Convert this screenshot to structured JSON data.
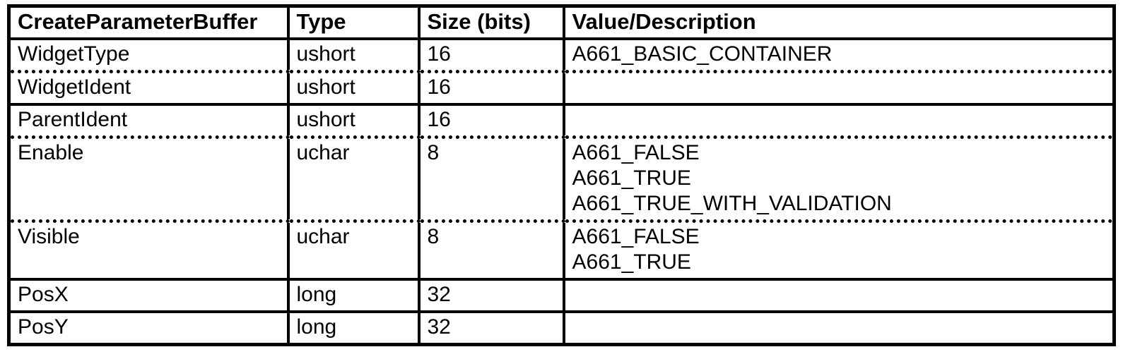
{
  "headers": {
    "name": "CreateParameterBuffer",
    "type": "Type",
    "size": "Size (bits)",
    "value": "Value/Description"
  },
  "rows": {
    "r1": {
      "name": "WidgetType",
      "type": "ushort",
      "size": "16",
      "value": "A661_BASIC_CONTAINER"
    },
    "r2": {
      "name": "WidgetIdent",
      "type": "ushort",
      "size": "16",
      "value": ""
    },
    "r3": {
      "name": "ParentIdent",
      "type": "ushort",
      "size": "16",
      "value": ""
    },
    "r4": {
      "name": "Enable",
      "type": "uchar",
      "size": "8",
      "values": {
        "v1": "A661_FALSE",
        "v2": "A661_TRUE",
        "v3": "A661_TRUE_WITH_VALIDATION"
      }
    },
    "r5": {
      "name": "Visible",
      "type": "uchar",
      "size": "8",
      "values": {
        "v1": "A661_FALSE",
        "v2": "A661_TRUE"
      }
    },
    "r6": {
      "name": "PosX",
      "type": "long",
      "size": "32",
      "value": ""
    },
    "r7": {
      "name": "PosY",
      "type": "long",
      "size": "32",
      "value": ""
    }
  }
}
